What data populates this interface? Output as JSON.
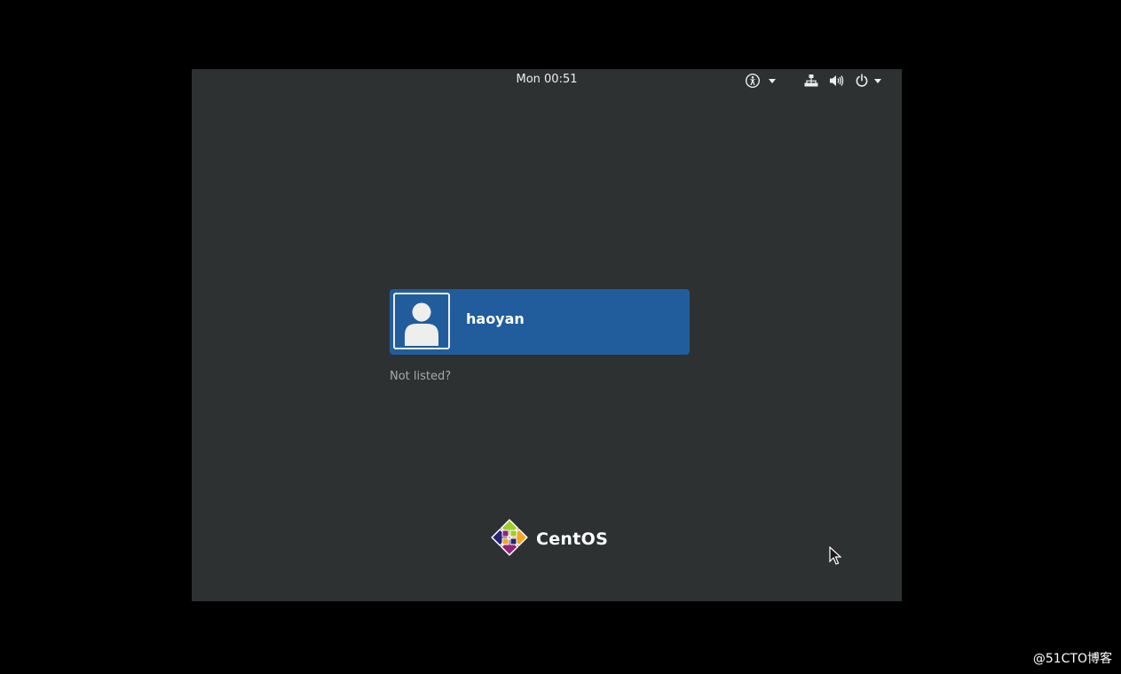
{
  "topbar": {
    "clock": "Mon 00:51",
    "accessibility_icon": "accessibility-icon",
    "network_icon": "network-wired-icon",
    "volume_icon": "volume-icon",
    "power_icon": "power-icon"
  },
  "login": {
    "users": [
      {
        "name": "haoyan",
        "avatar_icon": "user-avatar-icon"
      }
    ],
    "not_listed_label": "Not listed?"
  },
  "branding": {
    "logo_text": "CentOS",
    "logo_icon": "centos-logo-icon"
  },
  "watermark": "@51CTO博客",
  "colors": {
    "screen_background": "#2e3132",
    "selected_user_tile": "#215d9c",
    "text_primary": "#eeeeec",
    "text_secondary": "#a8aaa7"
  }
}
